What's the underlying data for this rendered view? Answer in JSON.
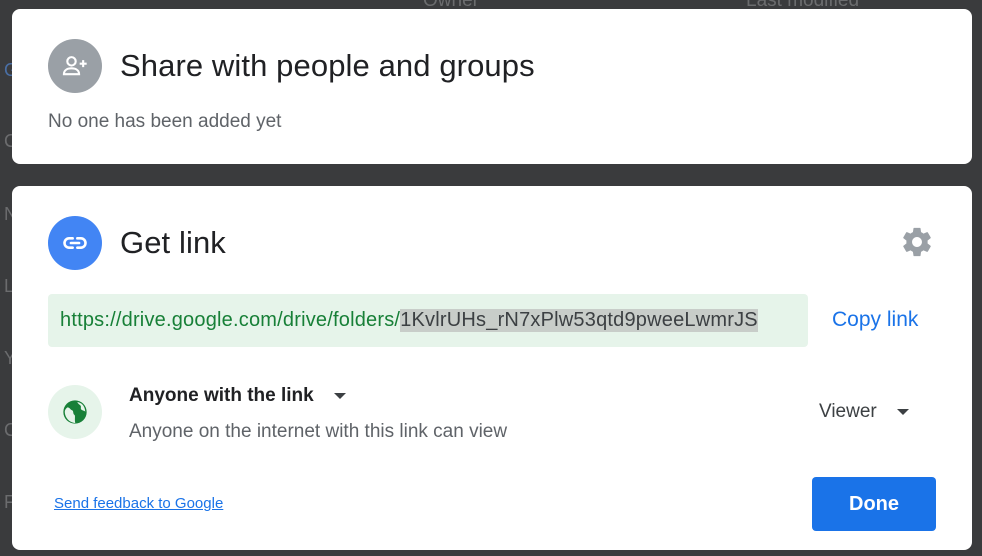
{
  "background": {
    "header_owner": "Owner",
    "header_modified": "Last modified",
    "row_letters": [
      "G",
      "C",
      "N",
      "L",
      "Y",
      "C",
      "F"
    ]
  },
  "share": {
    "title": "Share with people and groups",
    "subtitle": "No one has been added yet",
    "icon": "person-add-icon"
  },
  "link": {
    "title": "Get link",
    "icon": "link-icon",
    "settings_icon": "gear-icon",
    "url_prefix": "https://drive.google.com/drive/folders/",
    "url_selected": "1KvlrUHs_rN7xPlw53qtd9pweeLwmrJS",
    "copy_label": "Copy link",
    "access_label": "Anyone with the link",
    "access_desc": "Anyone on the internet with this link can view",
    "access_icon": "globe-icon",
    "role_label": "Viewer"
  },
  "footer": {
    "feedback_label": "Send feedback to Google",
    "done_label": "Done"
  },
  "colors": {
    "accent": "#1a73e8",
    "link_icon_bg": "#4285f4",
    "share_icon_bg": "#9aa0a6",
    "url_bg": "#e6f4ea",
    "url_text": "#188038",
    "globe": "#188038"
  }
}
